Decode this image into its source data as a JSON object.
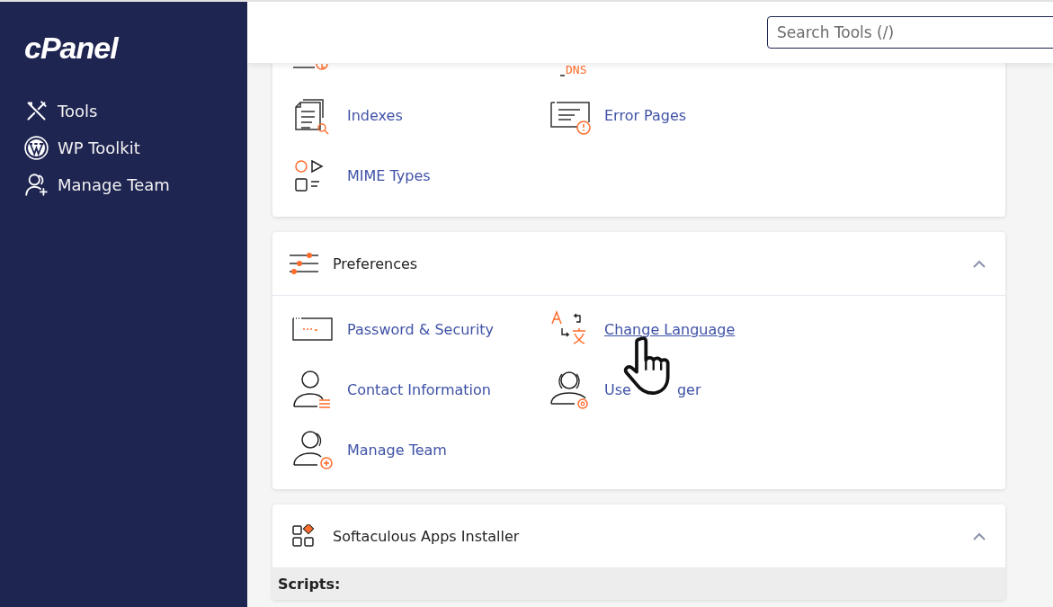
{
  "sidebar": {
    "logo": "cPanel",
    "items": [
      {
        "label": "Tools"
      },
      {
        "label": "WP Toolkit"
      },
      {
        "label": "Manage Team"
      }
    ]
  },
  "search": {
    "placeholder": "Search Tools (/)"
  },
  "sections": [
    {
      "kind": "plain",
      "partial_icon_text": "DNS",
      "items": [
        {
          "label": "Indexes",
          "hovered": false
        },
        {
          "label": "Error Pages",
          "hovered": false
        },
        {
          "label": "MIME Types",
          "hovered": false
        }
      ]
    },
    {
      "kind": "card",
      "title": "Preferences",
      "expanded": true,
      "items": [
        {
          "label": "Password & Security",
          "hovered": false
        },
        {
          "label": "Change Language",
          "hovered": true
        },
        {
          "label": "Contact Information",
          "hovered": false
        },
        {
          "label": "Use",
          "label_tail": "ger",
          "hovered": false
        },
        {
          "label": "Manage Team",
          "hovered": false
        }
      ]
    },
    {
      "kind": "card",
      "title": "Softaculous Apps Installer",
      "expanded": true,
      "subheading": "Scripts:"
    }
  ]
}
